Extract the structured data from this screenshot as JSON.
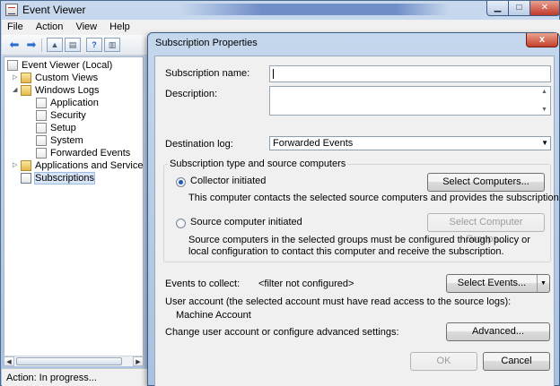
{
  "main_window": {
    "title": "Event Viewer",
    "menu": [
      "File",
      "Action",
      "View",
      "Help"
    ],
    "tree": [
      {
        "label": "Event Viewer (Local)",
        "twisty": "",
        "icon": "root",
        "level": 0
      },
      {
        "label": "Custom Views",
        "twisty": "▷",
        "icon": "folder",
        "level": 1
      },
      {
        "label": "Windows Logs",
        "twisty": "◢",
        "icon": "folder",
        "level": 1
      },
      {
        "label": "Application",
        "twisty": "",
        "icon": "log",
        "level": 2
      },
      {
        "label": "Security",
        "twisty": "",
        "icon": "log",
        "level": 2
      },
      {
        "label": "Setup",
        "twisty": "",
        "icon": "log",
        "level": 2
      },
      {
        "label": "System",
        "twisty": "",
        "icon": "log",
        "level": 2
      },
      {
        "label": "Forwarded Events",
        "twisty": "",
        "icon": "log",
        "level": 2
      },
      {
        "label": "Applications and Services Lo",
        "twisty": "▷",
        "icon": "folder",
        "level": 1
      },
      {
        "label": "Subscriptions",
        "twisty": "",
        "icon": "sub",
        "level": 1,
        "selected": true
      }
    ],
    "status": "Action:  In progress..."
  },
  "dialog": {
    "title": "Subscription Properties",
    "close_glyph": "x",
    "subscription_name_label": "Subscription name:",
    "subscription_name_value": "",
    "description_label": "Description:",
    "description_value": "",
    "destination_log_label": "Destination log:",
    "destination_log_value": "Forwarded Events",
    "group_title": "Subscription type and source computers",
    "collector_initiated_label": "Collector initiated",
    "collector_initiated_checked": true,
    "select_computers_button": "Select Computers...",
    "collector_description": "This computer contacts the selected source computers and provides the subscription.",
    "source_initiated_label": "Source computer initiated",
    "source_initiated_checked": false,
    "select_computer_groups_button": "Select Computer Groups...",
    "source_description_line1": "Source computers in the selected groups must be configured through policy or",
    "source_description_line2": "local configuration to contact this computer and receive the subscription.",
    "events_to_collect_label": "Events to collect:",
    "events_filter_value": "<filter not configured>",
    "select_events_button": "Select Events...",
    "user_account_label": "User account (the selected account must have read access to the source logs):",
    "user_account_value": "Machine Account",
    "advanced_settings_label": "Change user account or configure advanced settings:",
    "advanced_button": "Advanced...",
    "ok_button": "OK",
    "cancel_button": "Cancel"
  }
}
